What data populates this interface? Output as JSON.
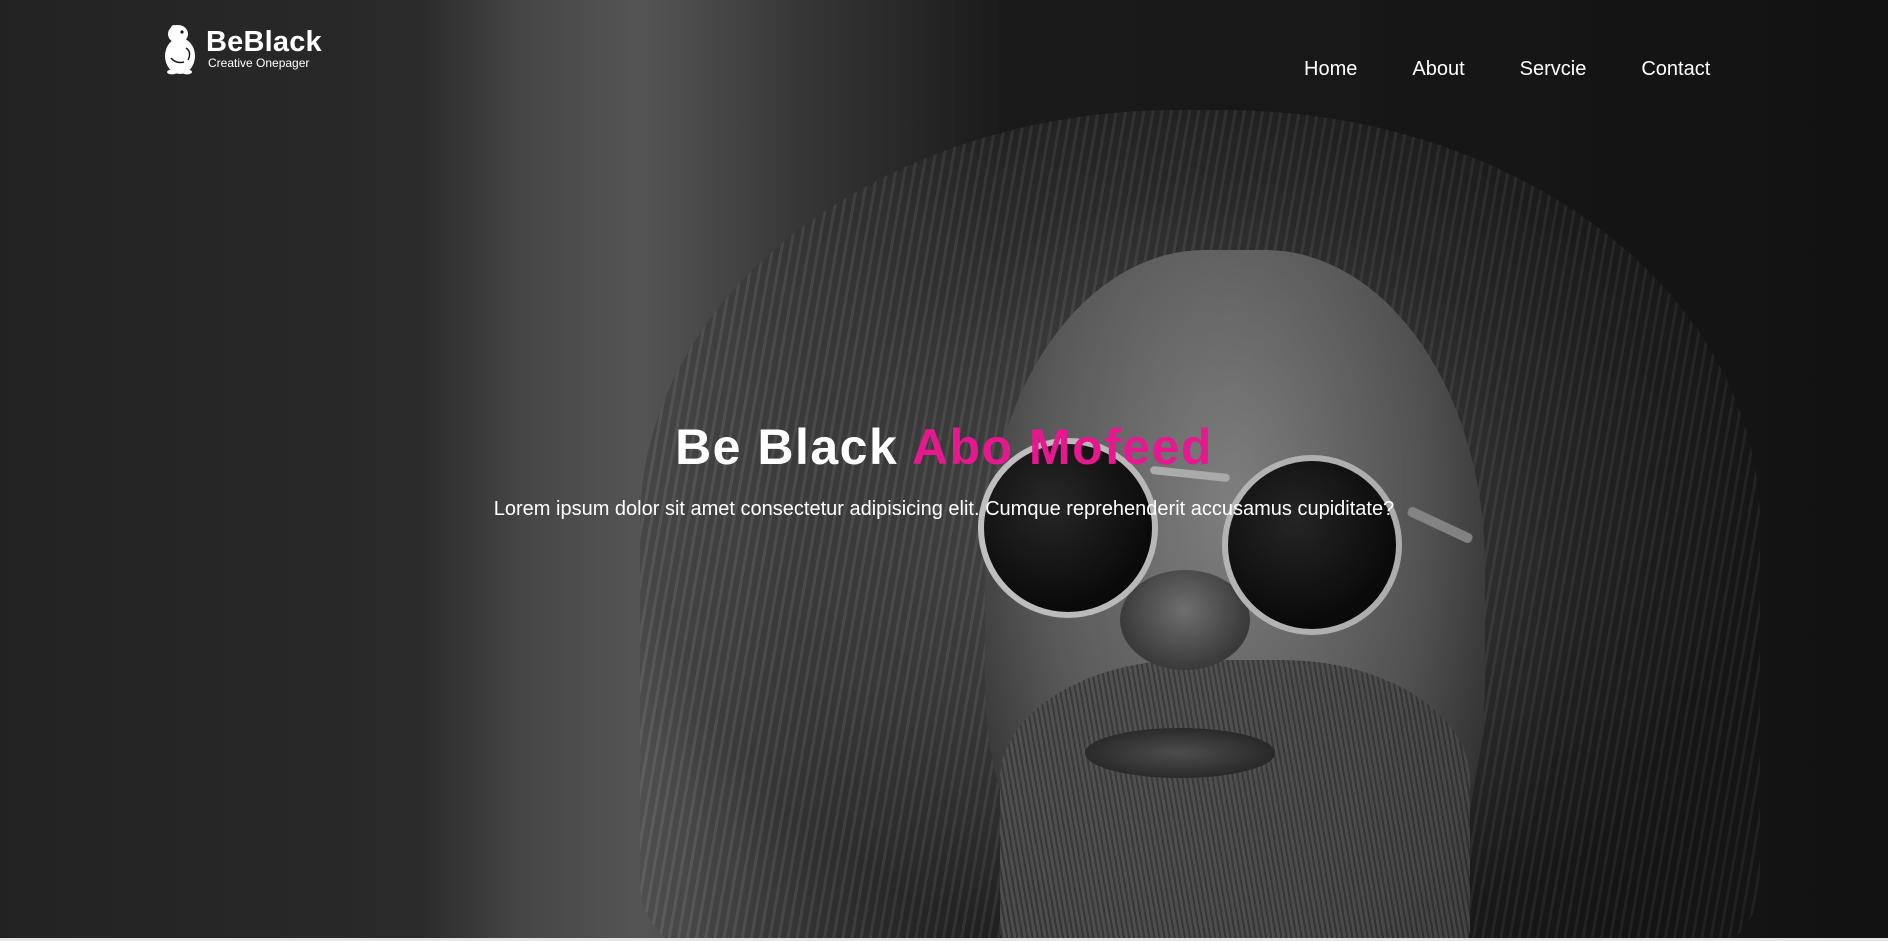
{
  "brand": {
    "name": "BeBlack",
    "tagline": "Creative Onepager"
  },
  "nav": {
    "items": [
      {
        "label": "Home"
      },
      {
        "label": "About"
      },
      {
        "label": "Servcie"
      },
      {
        "label": "Contact"
      }
    ]
  },
  "hero": {
    "title_main": "Be Black ",
    "title_accent": "Abo Mofeed",
    "subtitle": "Lorem ipsum dolor sit amet consectetur adipisicing elit. Cumque reprehenderit accusamus cupiditate?"
  },
  "colors": {
    "accent": "#e7188f",
    "text": "#ffffff"
  },
  "icons": {
    "logo": "beaver-logo-icon"
  }
}
